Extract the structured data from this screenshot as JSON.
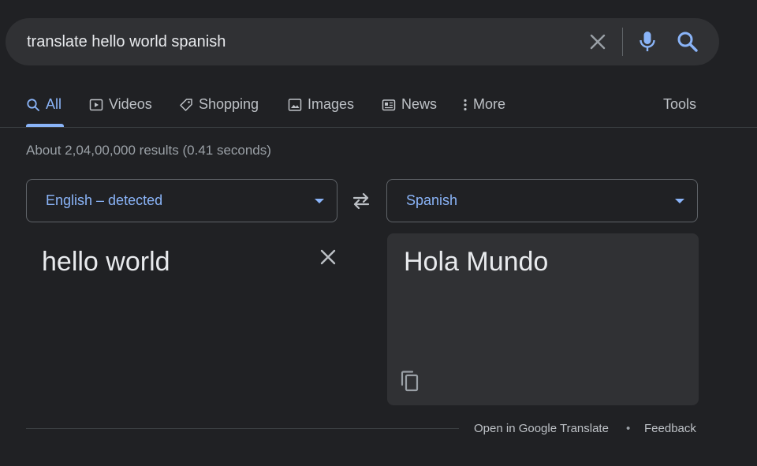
{
  "search": {
    "query": "translate hello world spanish"
  },
  "tabs": [
    {
      "label": "All",
      "icon": "search-icon",
      "active": true
    },
    {
      "label": "Videos",
      "icon": "video-icon"
    },
    {
      "label": "Shopping",
      "icon": "tag-icon"
    },
    {
      "label": "Images",
      "icon": "image-icon"
    },
    {
      "label": "News",
      "icon": "news-icon"
    },
    {
      "label": "More",
      "icon": "more-vert-icon"
    },
    {
      "label": "Tools"
    }
  ],
  "results_stats": "About 2,04,00,000 results (0.41 seconds)",
  "translator": {
    "source_language": "English – detected",
    "target_language": "Spanish",
    "source_text": "hello world",
    "translated_text": "Hola Mundo"
  },
  "footer": {
    "open_link": "Open in Google Translate",
    "separator": "•",
    "feedback": "Feedback"
  },
  "colors": {
    "background": "#202124",
    "surface": "#303134",
    "accent": "#8ab4f8",
    "text": "#e8eaed",
    "muted": "#9aa0a6"
  }
}
